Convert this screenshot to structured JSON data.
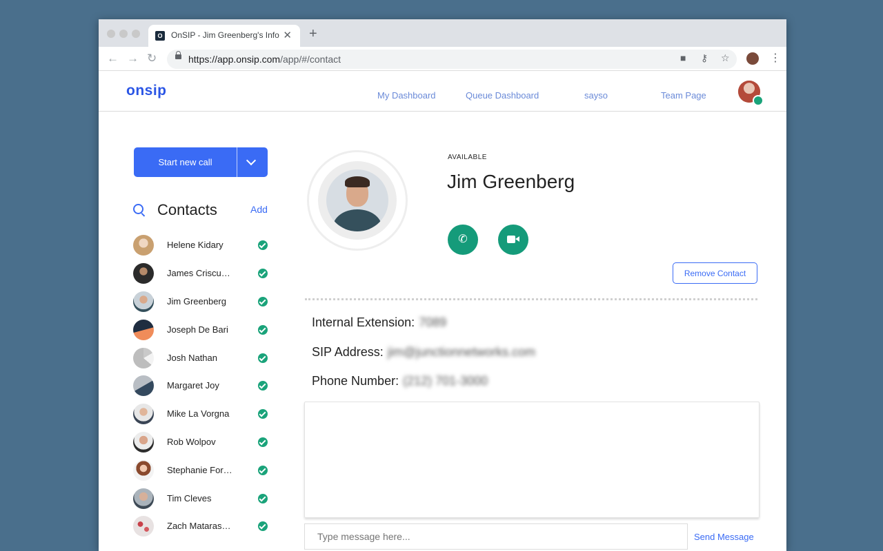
{
  "browser": {
    "tab_title": "OnSIP - Jim Greenberg's Info",
    "tab_favicon": "O",
    "url_host": "https://app.onsip.com",
    "url_path": "/app/#/contact",
    "icons": [
      "video-camera-icon",
      "key-icon",
      "star-icon",
      "profile-icon",
      "kebab-menu-icon"
    ]
  },
  "header": {
    "logo": "onsip",
    "nav": [
      "My Dashboard",
      "Queue Dashboard",
      "sayso",
      "Team Page"
    ]
  },
  "sidebar": {
    "start_call_label": "Start new call",
    "contacts_title": "Contacts",
    "add_label": "Add",
    "contacts": [
      {
        "name": "Helene Kidary",
        "status_color": "#1aa37a"
      },
      {
        "name": "James Criscu…",
        "status_color": "#1aa37a"
      },
      {
        "name": "Jim Greenberg",
        "status_color": "#1aa37a"
      },
      {
        "name": "Joseph De Bari",
        "status_color": "#1aa37a"
      },
      {
        "name": "Josh Nathan",
        "status_color": "#1aa37a"
      },
      {
        "name": "Margaret Joy",
        "status_color": "#1aa37a"
      },
      {
        "name": "Mike La Vorgna",
        "status_color": "#1aa37a"
      },
      {
        "name": "Rob Wolpov",
        "status_color": "#1aa37a"
      },
      {
        "name": "Stephanie For…",
        "status_color": "#1aa37a"
      },
      {
        "name": "Tim Cleves",
        "status_color": "#1aa37a"
      },
      {
        "name": "Zach Mataras…",
        "status_color": "#1aa37a"
      }
    ]
  },
  "contact": {
    "status": "AVAILABLE",
    "name": "Jim Greenberg",
    "remove_label": "Remove Contact",
    "internal_extension_label": "Internal Extension:",
    "internal_extension_value": "7089",
    "sip_address_label": "SIP Address:",
    "sip_address_value": "jim@junctionnetworks.com",
    "phone_number_label": "Phone Number:",
    "phone_number_value": "(212) 701-3000"
  },
  "message": {
    "placeholder": "Type message here...",
    "send_label": "Send Message"
  },
  "colors": {
    "accent": "#3a6bf5",
    "available": "#1aa37a",
    "background": "#4a6f8c"
  }
}
